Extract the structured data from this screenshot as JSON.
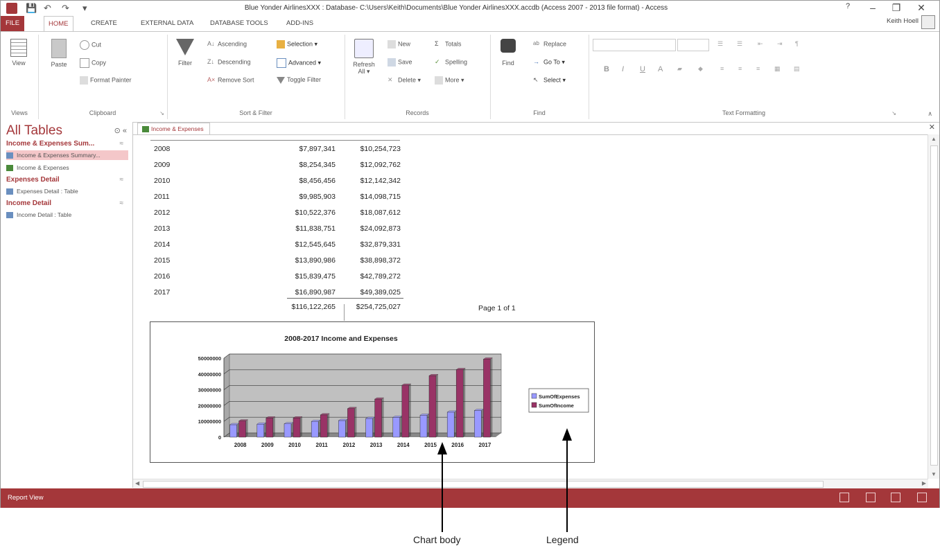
{
  "titlebar": {
    "title": "Blue Yonder AirlinesXXX : Database- C:\\Users\\Keith\\Documents\\Blue Yonder AirlinesXXX.accdb (Access 2007 - 2013 file format) - Access",
    "help": "?",
    "minimize": "–",
    "restore": "❐",
    "close": "✕"
  },
  "tabs": [
    "FILE",
    "HOME",
    "CREATE",
    "EXTERNAL DATA",
    "DATABASE TOOLS",
    "ADD-INS"
  ],
  "user": "Keith Hoell",
  "ribbon": {
    "views": {
      "view": "View",
      "label": "Views"
    },
    "clipboard": {
      "paste": "Paste",
      "cut": "Cut",
      "copy": "Copy",
      "format_painter": "Format Painter",
      "label": "Clipboard"
    },
    "sort_filter": {
      "filter": "Filter",
      "ascending": "Ascending",
      "descending": "Descending",
      "remove_sort": "Remove Sort",
      "selection": "Selection",
      "advanced": "Advanced",
      "toggle_filter": "Toggle Filter",
      "label": "Sort & Filter"
    },
    "records": {
      "refresh": "Refresh",
      "refresh_sub": "All",
      "new": "New",
      "save": "Save",
      "delete": "Delete",
      "totals": "Totals",
      "spelling": "Spelling",
      "more": "More",
      "label": "Records"
    },
    "find": {
      "find": "Find",
      "replace": "Replace",
      "goto": "Go To",
      "select": "Select",
      "label": "Find"
    },
    "text_formatting": {
      "bold": "B",
      "italic": "I",
      "underline": "U",
      "font_color": "A",
      "label": "Text Formatting"
    }
  },
  "nav": {
    "title": "All Tables",
    "groups": [
      {
        "name": "Income & Expenses Sum...",
        "items": [
          "Income & Expenses Summary...",
          "Income & Expenses"
        ]
      },
      {
        "name": "Expenses Detail",
        "items": [
          "Expenses Detail : Table"
        ]
      },
      {
        "name": "Income Detail",
        "items": [
          "Income Detail : Table"
        ]
      }
    ]
  },
  "doc_tab": "Income & Expenses",
  "report": {
    "rows": [
      {
        "year": "2008",
        "expenses": "$7,897,341",
        "income": "$10,254,723"
      },
      {
        "year": "2009",
        "expenses": "$8,254,345",
        "income": "$12,092,762"
      },
      {
        "year": "2010",
        "expenses": "$8,456,456",
        "income": "$12,142,342"
      },
      {
        "year": "2011",
        "expenses": "$9,985,903",
        "income": "$14,098,715"
      },
      {
        "year": "2012",
        "expenses": "$10,522,376",
        "income": "$18,087,612"
      },
      {
        "year": "2013",
        "expenses": "$11,838,751",
        "income": "$24,092,873"
      },
      {
        "year": "2014",
        "expenses": "$12,545,645",
        "income": "$32,879,331"
      },
      {
        "year": "2015",
        "expenses": "$13,890,986",
        "income": "$38,898,372"
      },
      {
        "year": "2016",
        "expenses": "$15,839,475",
        "income": "$42,789,272"
      },
      {
        "year": "2017",
        "expenses": "$16,890,987",
        "income": "$49,389,025"
      }
    ],
    "total_expenses": "$116,122,265",
    "total_income": "$254,725,027",
    "page": "Page 1 of 1"
  },
  "chart_data": {
    "type": "bar",
    "title": "2008-2017 Income and Expenses",
    "categories": [
      "2008",
      "2009",
      "2010",
      "2011",
      "2012",
      "2013",
      "2014",
      "2015",
      "2016",
      "2017"
    ],
    "series": [
      {
        "name": "SumOfExpenses",
        "color": "#9999ff",
        "values": [
          7897341,
          8254345,
          8456456,
          9985903,
          10522376,
          11838751,
          12545645,
          13890986,
          15839475,
          16890987
        ]
      },
      {
        "name": "SumOfIncome",
        "color": "#993366",
        "values": [
          10254723,
          12092762,
          12142342,
          14098715,
          18087612,
          24092873,
          32879331,
          38898372,
          42789272,
          49389025
        ]
      }
    ],
    "yticks": [
      "0",
      "10000000",
      "20000000",
      "30000000",
      "40000000",
      "50000000"
    ],
    "ylim": [
      0,
      50000000
    ],
    "legend": "right",
    "grid": true
  },
  "status": "Report View",
  "callouts": {
    "chart_body": "Chart body",
    "legend": "Legend"
  },
  "colors": {
    "accent": "#a4373a",
    "nav_selected": "#f4c7c9"
  }
}
